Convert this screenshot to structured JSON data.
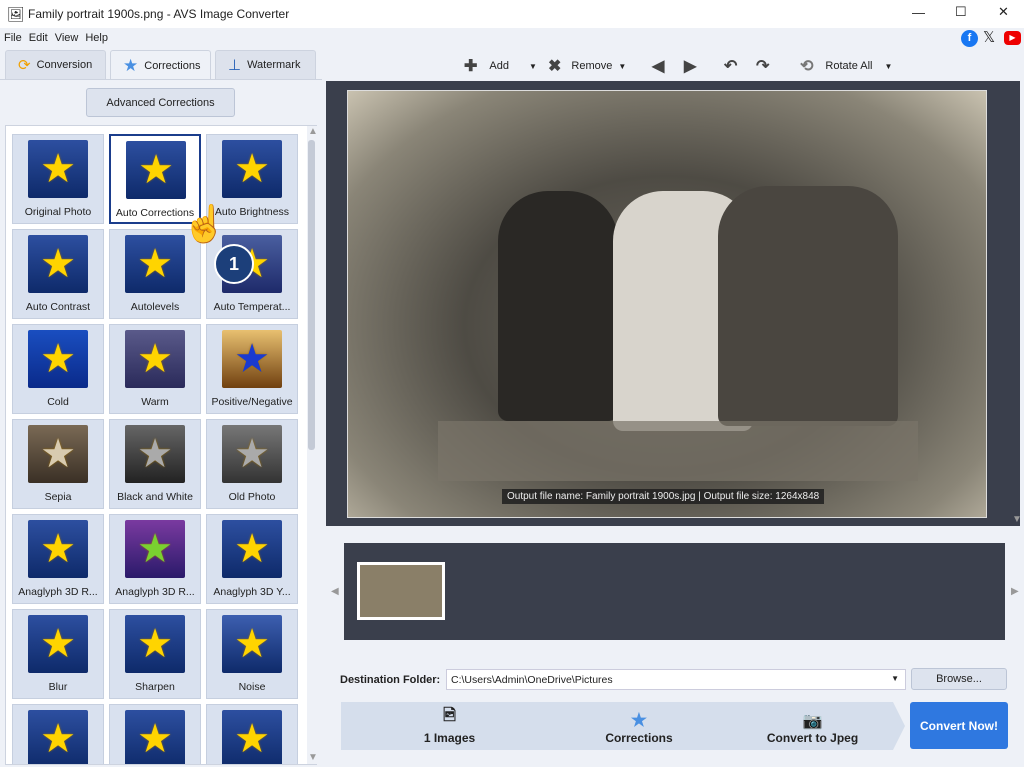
{
  "window": {
    "title": "Family portrait 1900s.png - AVS Image Converter",
    "minimize": "—",
    "maximize": "☐",
    "close": "✕"
  },
  "menu": [
    "File",
    "Edit",
    "View",
    "Help"
  ],
  "tabs": [
    {
      "label": "Conversion"
    },
    {
      "label": "Corrections"
    },
    {
      "label": "Watermark"
    }
  ],
  "advanced_button": "Advanced Corrections",
  "corrections": [
    {
      "label": "Original Photo"
    },
    {
      "label": "Auto Corrections"
    },
    {
      "label": "Auto Brightness"
    },
    {
      "label": "Auto Contrast"
    },
    {
      "label": "Autolevels"
    },
    {
      "label": "Auto Temperat..."
    },
    {
      "label": "Cold"
    },
    {
      "label": "Warm"
    },
    {
      "label": "Positive/Negative"
    },
    {
      "label": "Sepia"
    },
    {
      "label": "Black and White"
    },
    {
      "label": "Old Photo"
    },
    {
      "label": "Anaglyph 3D R..."
    },
    {
      "label": "Anaglyph 3D R..."
    },
    {
      "label": "Anaglyph 3D Y..."
    },
    {
      "label": "Blur"
    },
    {
      "label": "Sharpen"
    },
    {
      "label": "Noise"
    },
    {
      "label": ""
    },
    {
      "label": ""
    },
    {
      "label": ""
    }
  ],
  "step_badge": "1",
  "toolbar": {
    "add": "Add",
    "remove": "Remove",
    "rotate_all": "Rotate All"
  },
  "preview": {
    "caption": "Output file name: Family portrait 1900s.jpg | Output file size: 1264x848"
  },
  "destination": {
    "label": "Destination Folder:",
    "value": "C:\\Users\\Admin\\OneDrive\\Pictures",
    "browse": "Browse..."
  },
  "steps": [
    {
      "label": "1 Images"
    },
    {
      "label": "Corrections"
    },
    {
      "label": "Convert to Jpeg"
    }
  ],
  "convert_button": "Convert Now!"
}
